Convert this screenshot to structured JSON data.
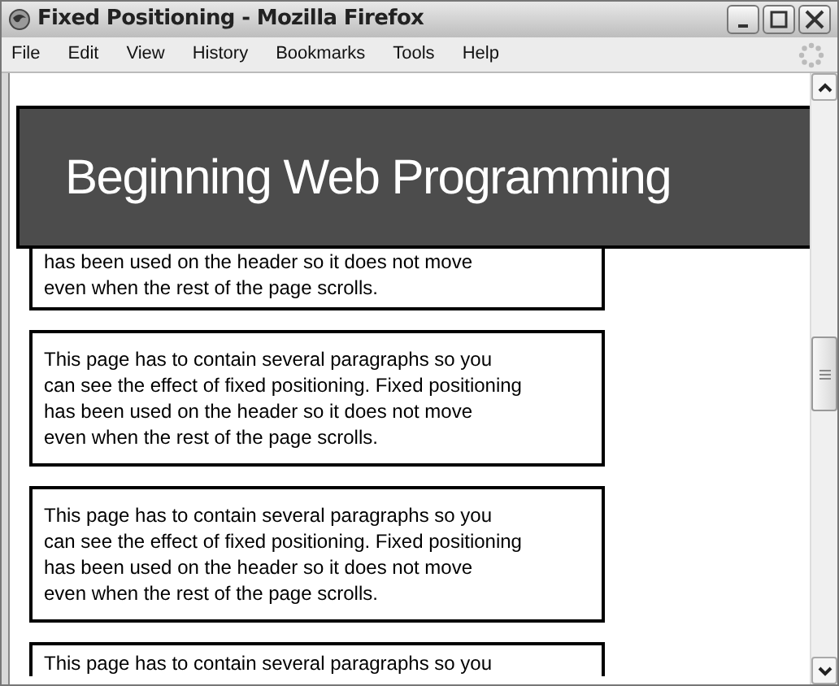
{
  "window": {
    "title": "Fixed Positioning - Mozilla Firefox"
  },
  "menu": [
    "File",
    "Edit",
    "View",
    "History",
    "Bookmarks",
    "Tools",
    "Help"
  ],
  "header": {
    "title": "Beginning Web Programming"
  },
  "paragraphs": [
    {
      "lines": [
        "has been used on the header so it does not move",
        "even when the rest of the page scrolls."
      ],
      "kind": "top-hidden"
    },
    {
      "lines": [
        "This page has to contain several paragraphs so you",
        "can see the effect of fixed positioning. Fixed positioning",
        "has been used on the header so it does not move",
        "even when the rest of the page scrolls."
      ],
      "kind": "full"
    },
    {
      "lines": [
        "This page has to contain several paragraphs so you",
        "can see the effect of fixed positioning. Fixed positioning",
        "has been used on the header so it does not move",
        "even when the rest of the page scrolls."
      ],
      "kind": "full"
    },
    {
      "lines": [
        "This page has to contain several paragraphs so you"
      ],
      "kind": "bottom-hidden"
    }
  ]
}
